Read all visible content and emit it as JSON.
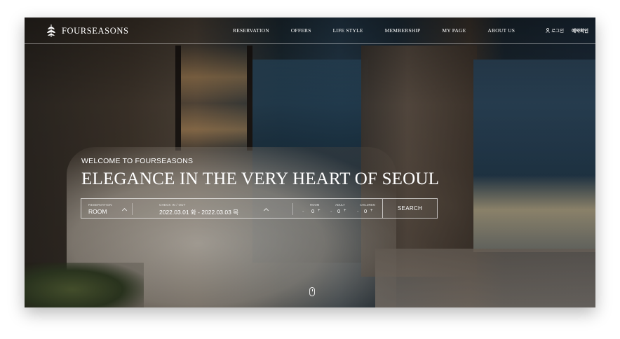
{
  "brand": {
    "name": "FOURSEASONS",
    "logo_icon": "leaf-icon"
  },
  "nav": {
    "menu": [
      {
        "label": "RESERVATION"
      },
      {
        "label": "OFFERS"
      },
      {
        "label": "LIFE STYLE"
      },
      {
        "label": "MEMBERSHIP"
      },
      {
        "label": "MY PAGE"
      },
      {
        "label": "ABOUT US"
      }
    ],
    "login_label": "로그인",
    "login_icon": "user-icon",
    "check_reservation_label": "예약확인"
  },
  "hero": {
    "welcome": "WELCOME TO FOURSEASONS",
    "headline": "ELEGANCE IN THE VERY HEART OF SEOUL"
  },
  "booking": {
    "reservation_label": "RESERVATION",
    "reservation_value": "ROOM",
    "dates_label": "CHECK IN / OUT",
    "dates_value": "2022.03.01 화 - 2022.03.03 목",
    "room_label": "ROOM",
    "room_value": "0",
    "adult_label": "ADULT",
    "adult_value": "0",
    "children_label": "CHILDREN",
    "children_value": "0",
    "minus": "-",
    "plus": "+",
    "search_label": "SEARCH"
  },
  "scroll_icon": "mouse-icon",
  "colors": {
    "text": "#ffffff",
    "border": "#ffffffa6"
  }
}
